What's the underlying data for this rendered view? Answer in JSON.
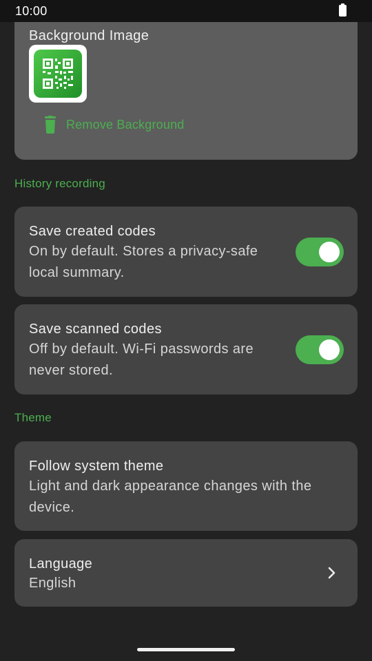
{
  "status_bar": {
    "time": "10:00",
    "battery_icon": "battery-full-icon"
  },
  "background_image": {
    "title": "Background Image",
    "thumbnail_icon": "qr-code-icon",
    "remove_icon": "trash-icon",
    "remove_label": "Remove Background"
  },
  "history": {
    "header": "History recording",
    "items": [
      {
        "title": "Save created codes",
        "line1": "On by default. Stores a privacy-safe",
        "line2": "local summary.",
        "enabled": true
      },
      {
        "title": "Save scanned codes",
        "line1": "Off by default. Wi-Fi passwords are",
        "line2": "never stored.",
        "enabled": true
      }
    ]
  },
  "theme": {
    "header": "Theme",
    "follow_system": {
      "title": "Follow system theme",
      "line1": "Light and dark appearance changes with the",
      "line2": "device."
    },
    "language": {
      "title": "Language",
      "value": "English",
      "chevron_icon": "chevron-right-icon"
    }
  },
  "colors": {
    "accent": "#4caf50",
    "background": "#222222",
    "card": "#444444"
  }
}
